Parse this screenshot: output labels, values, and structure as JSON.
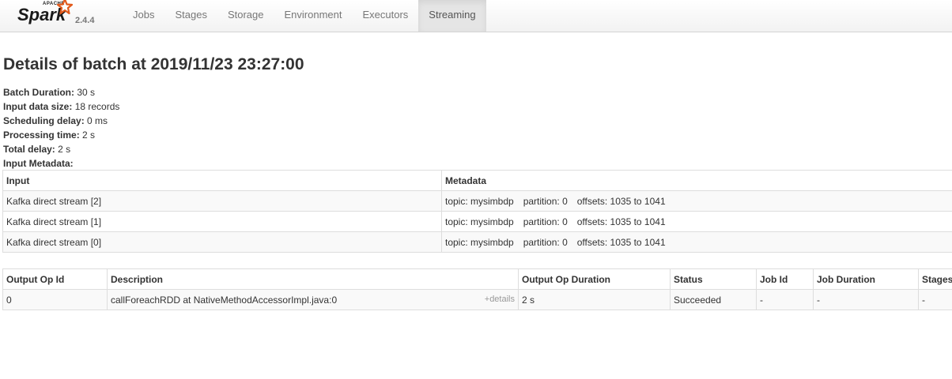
{
  "brand": {
    "apache": "APACHE",
    "name": "Spark",
    "version": "2.4.4"
  },
  "nav": {
    "tabs": [
      "Jobs",
      "Stages",
      "Storage",
      "Environment",
      "Executors",
      "Streaming"
    ],
    "active": "Streaming"
  },
  "page": {
    "title": "Details of batch at 2019/11/23 23:27:00"
  },
  "summary": [
    {
      "label": "Batch Duration:",
      "value": "30 s"
    },
    {
      "label": "Input data size:",
      "value": "18 records"
    },
    {
      "label": "Scheduling delay:",
      "value": "0 ms"
    },
    {
      "label": "Processing time:",
      "value": "2 s"
    },
    {
      "label": "Total delay:",
      "value": "2 s"
    },
    {
      "label": "Input Metadata:",
      "value": ""
    }
  ],
  "metadata_table": {
    "headers": [
      "Input",
      "Metadata"
    ],
    "rows": [
      {
        "input": "Kafka direct stream [2]",
        "topic": "topic: mysimbdp",
        "partition": "partition: 0",
        "offsets": "offsets: 1035 to 1041"
      },
      {
        "input": "Kafka direct stream [1]",
        "topic": "topic: mysimbdp",
        "partition": "partition: 0",
        "offsets": "offsets: 1035 to 1041"
      },
      {
        "input": "Kafka direct stream [0]",
        "topic": "topic: mysimbdp",
        "partition": "partition: 0",
        "offsets": "offsets: 1035 to 1041"
      }
    ]
  },
  "ops_table": {
    "headers": [
      "Output Op Id",
      "Description",
      "Output Op Duration",
      "Status",
      "Job Id",
      "Job Duration",
      "Stages"
    ],
    "rows": [
      {
        "op_id": "0",
        "description": "callForeachRDD at NativeMethodAccessorImpl.java:0",
        "details_link": "+details",
        "duration": "2 s",
        "status": "Succeeded",
        "job_id": "-",
        "job_duration": "-",
        "stages": "-"
      }
    ]
  }
}
